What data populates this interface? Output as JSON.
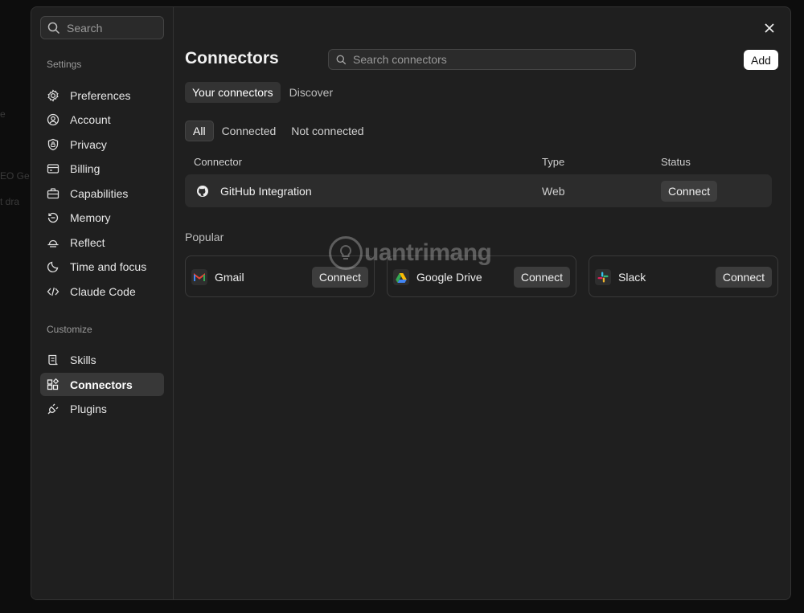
{
  "sidebar": {
    "search_placeholder": "Search",
    "settings_label": "Settings",
    "settings_items": [
      {
        "label": "Preferences",
        "icon": "gear-icon"
      },
      {
        "label": "Account",
        "icon": "user-circle-icon"
      },
      {
        "label": "Privacy",
        "icon": "shield-lock-icon"
      },
      {
        "label": "Billing",
        "icon": "credit-card-icon"
      },
      {
        "label": "Capabilities",
        "icon": "briefcase-icon"
      },
      {
        "label": "Memory",
        "icon": "history-icon"
      },
      {
        "label": "Reflect",
        "icon": "sunrise-icon"
      },
      {
        "label": "Time and focus",
        "icon": "moon-icon"
      },
      {
        "label": "Claude Code",
        "icon": "code-icon"
      }
    ],
    "customize_label": "Customize",
    "customize_items": [
      {
        "label": "Skills",
        "icon": "scroll-icon"
      },
      {
        "label": "Connectors",
        "icon": "blocks-icon",
        "active": true
      },
      {
        "label": "Plugins",
        "icon": "plug-icon"
      }
    ]
  },
  "main": {
    "title": "Connectors",
    "search_placeholder": "Search connectors",
    "add_label": "Add",
    "tabs": [
      {
        "label": "Your connectors",
        "active": true
      },
      {
        "label": "Discover"
      }
    ],
    "filters": [
      {
        "label": "All",
        "active": true
      },
      {
        "label": "Connected"
      },
      {
        "label": "Not connected"
      }
    ],
    "table": {
      "headers": [
        "Connector",
        "Type",
        "Status"
      ],
      "rows": [
        {
          "name": "GitHub Integration",
          "type": "Web",
          "action": "Connect",
          "icon": "github-icon"
        }
      ]
    },
    "popular_label": "Popular",
    "popular": [
      {
        "name": "Gmail",
        "action": "Connect",
        "icon": "gmail-icon"
      },
      {
        "name": "Google Drive",
        "action": "Connect",
        "icon": "google-drive-icon"
      },
      {
        "name": "Slack",
        "action": "Connect",
        "icon": "slack-icon"
      }
    ]
  },
  "watermark": "uantrimang",
  "colors": {
    "background": "#0d0d0d",
    "panel": "#1f1f1f",
    "active_item": "#383838",
    "button": "#3d3d3d",
    "add_button": "#ffffff"
  }
}
